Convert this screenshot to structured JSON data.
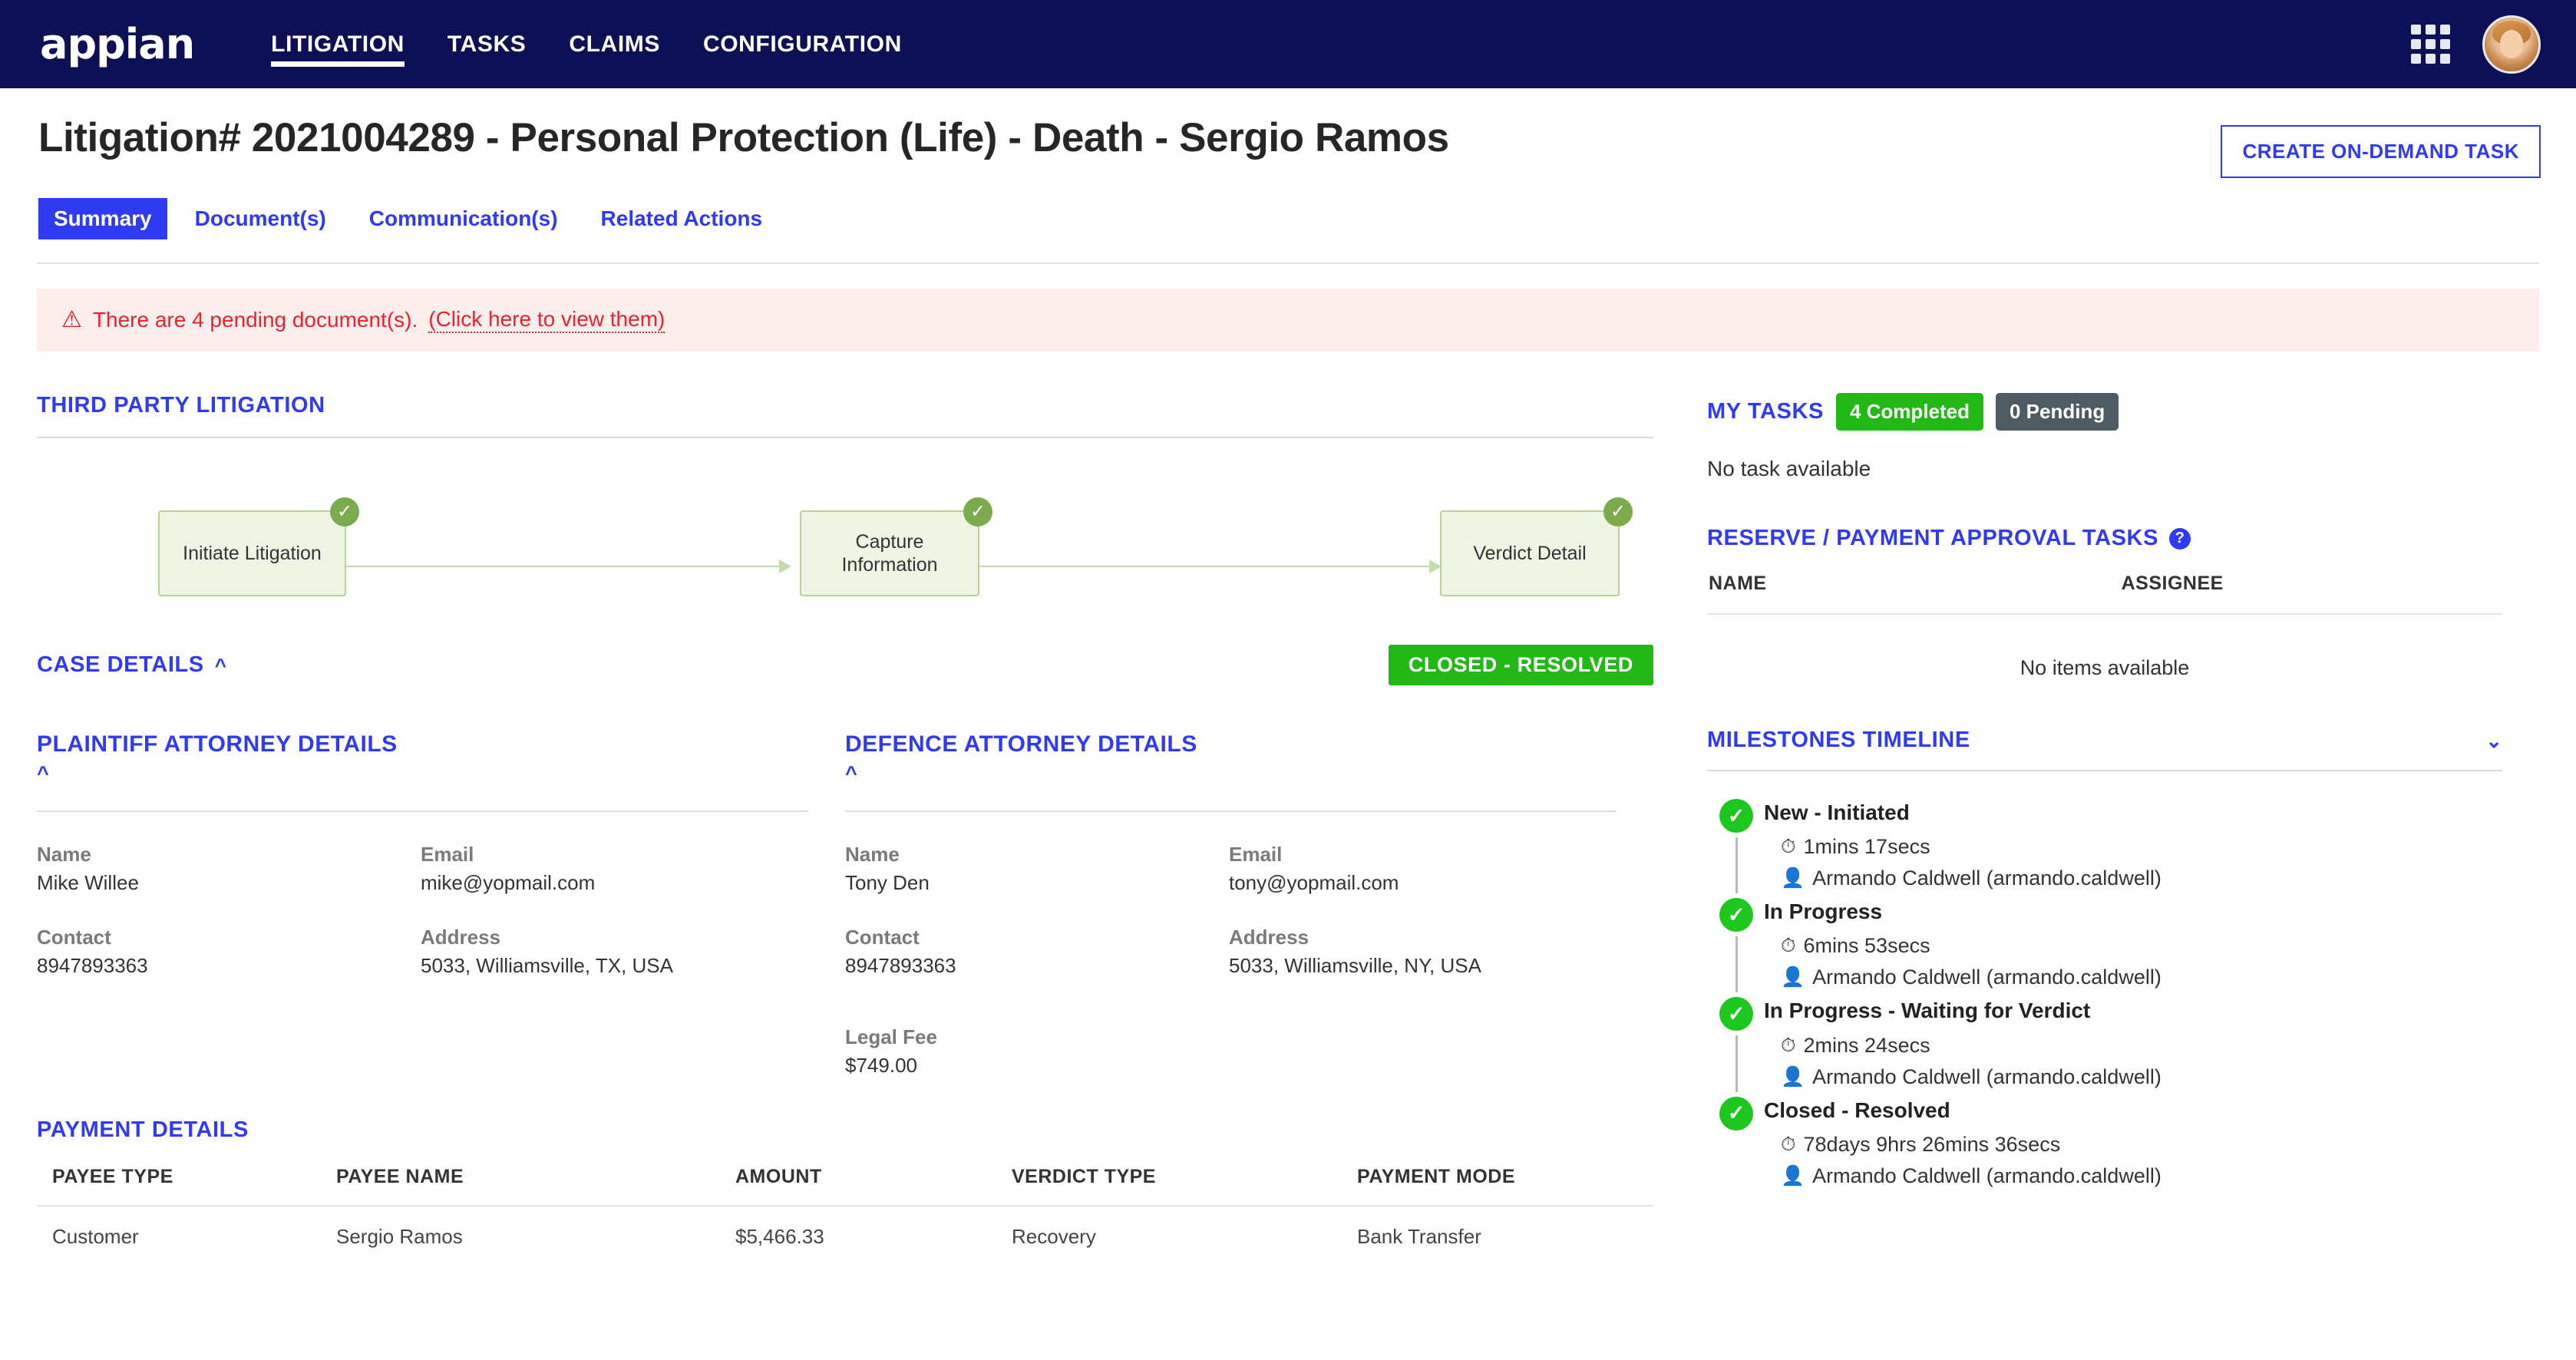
{
  "navbar": {
    "logo": "appian",
    "links": [
      {
        "label": "LITIGATION",
        "active": true
      },
      {
        "label": "TASKS",
        "active": false
      },
      {
        "label": "CLAIMS",
        "active": false
      },
      {
        "label": "CONFIGURATION",
        "active": false
      }
    ],
    "grid_icon": "apps-grid-icon",
    "avatar": "user-avatar"
  },
  "header": {
    "title": "Litigation# 2021004289 - Personal Protection (Life) - Death - Sergio Ramos",
    "action_button": "CREATE ON-DEMAND TASK"
  },
  "tabs": [
    {
      "label": "Summary",
      "active": true
    },
    {
      "label": "Document(s)",
      "active": false
    },
    {
      "label": "Communication(s)",
      "active": false
    },
    {
      "label": "Related Actions",
      "active": false
    }
  ],
  "alert": {
    "icon": "warning-triangle-icon",
    "text": "There are 4 pending document(s).",
    "link": "(Click here to view them)",
    "color": "#e8232b",
    "background": "#fdeeee"
  },
  "third_party_litigation": {
    "heading": "THIRD PARTY LITIGATION",
    "nodes": [
      {
        "label": "Initiate Litigation",
        "completed": true
      },
      {
        "label": "Capture Information",
        "completed": true
      },
      {
        "label": "Verdict Detail",
        "completed": true
      }
    ],
    "node_fill": "#eef5e5",
    "node_border": "#b7d493",
    "badge_color": "#7cab4e"
  },
  "case_details": {
    "heading": "CASE  DETAILS",
    "chevron": "chevron-up-icon",
    "status": "CLOSED - RESOLVED",
    "status_color": "#22b816"
  },
  "plaintiff_attorney": {
    "heading": "PLAINTIFF ATTORNEY DETAILS",
    "chevron": "chevron-up-icon",
    "fields": [
      {
        "label": "Name",
        "value": "Mike Willee"
      },
      {
        "label": "Email",
        "value": "mike@yopmail.com"
      },
      {
        "label": "Contact",
        "value": "8947893363"
      },
      {
        "label": "Address",
        "value": "5033, Williamsville, TX, USA"
      }
    ]
  },
  "defence_attorney": {
    "heading": "DEFENCE ATTORNEY DETAILS",
    "chevron": "chevron-up-icon",
    "fields": [
      {
        "label": "Name",
        "value": "Tony Den"
      },
      {
        "label": "Email",
        "value": "tony@yopmail.com"
      },
      {
        "label": "Contact",
        "value": "8947893363"
      },
      {
        "label": "Address",
        "value": "5033, Williamsville, NY, USA"
      }
    ],
    "legal_fee_label": "Legal Fee",
    "legal_fee_value": "$749.00"
  },
  "payment_details": {
    "heading": "PAYMENT DETAILS",
    "columns": [
      "PAYEE TYPE",
      "PAYEE NAME",
      "AMOUNT",
      "VERDICT TYPE",
      "PAYMENT MODE"
    ],
    "rows": [
      [
        "Customer",
        "Sergio Ramos",
        "$5,466.33",
        "Recovery",
        "Bank Transfer"
      ]
    ]
  },
  "my_tasks": {
    "heading": "MY TASKS",
    "completed_badge": "4 Completed",
    "pending_badge": "0 Pending",
    "empty_text": "No task available"
  },
  "reserve_payment_tasks": {
    "heading": "RESERVE / PAYMENT APPROVAL TASKS",
    "help_icon": "help-circle-icon",
    "columns": [
      "NAME",
      "ASSIGNEE"
    ],
    "empty_text": "No items available"
  },
  "milestones_timeline": {
    "heading": "MILESTONES TIMELINE",
    "chevron": "chevron-down-icon",
    "items": [
      {
        "title": "New - Initiated",
        "duration": "1mins 17secs",
        "user": "Armando Caldwell (armando.caldwell)"
      },
      {
        "title": "In Progress",
        "duration": "6mins 53secs",
        "user": "Armando Caldwell (armando.caldwell)"
      },
      {
        "title": "In Progress - Waiting for Verdict",
        "duration": "2mins 24secs",
        "user": "Armando Caldwell (armando.caldwell)"
      },
      {
        "title": "Closed - Resolved",
        "duration": "78days 9hrs 26mins 36secs",
        "user": "Armando Caldwell (armando.caldwell)"
      }
    ],
    "clock_icon": "clock-icon",
    "user_icon": "person-icon",
    "check_icon": "check-circle-icon"
  }
}
